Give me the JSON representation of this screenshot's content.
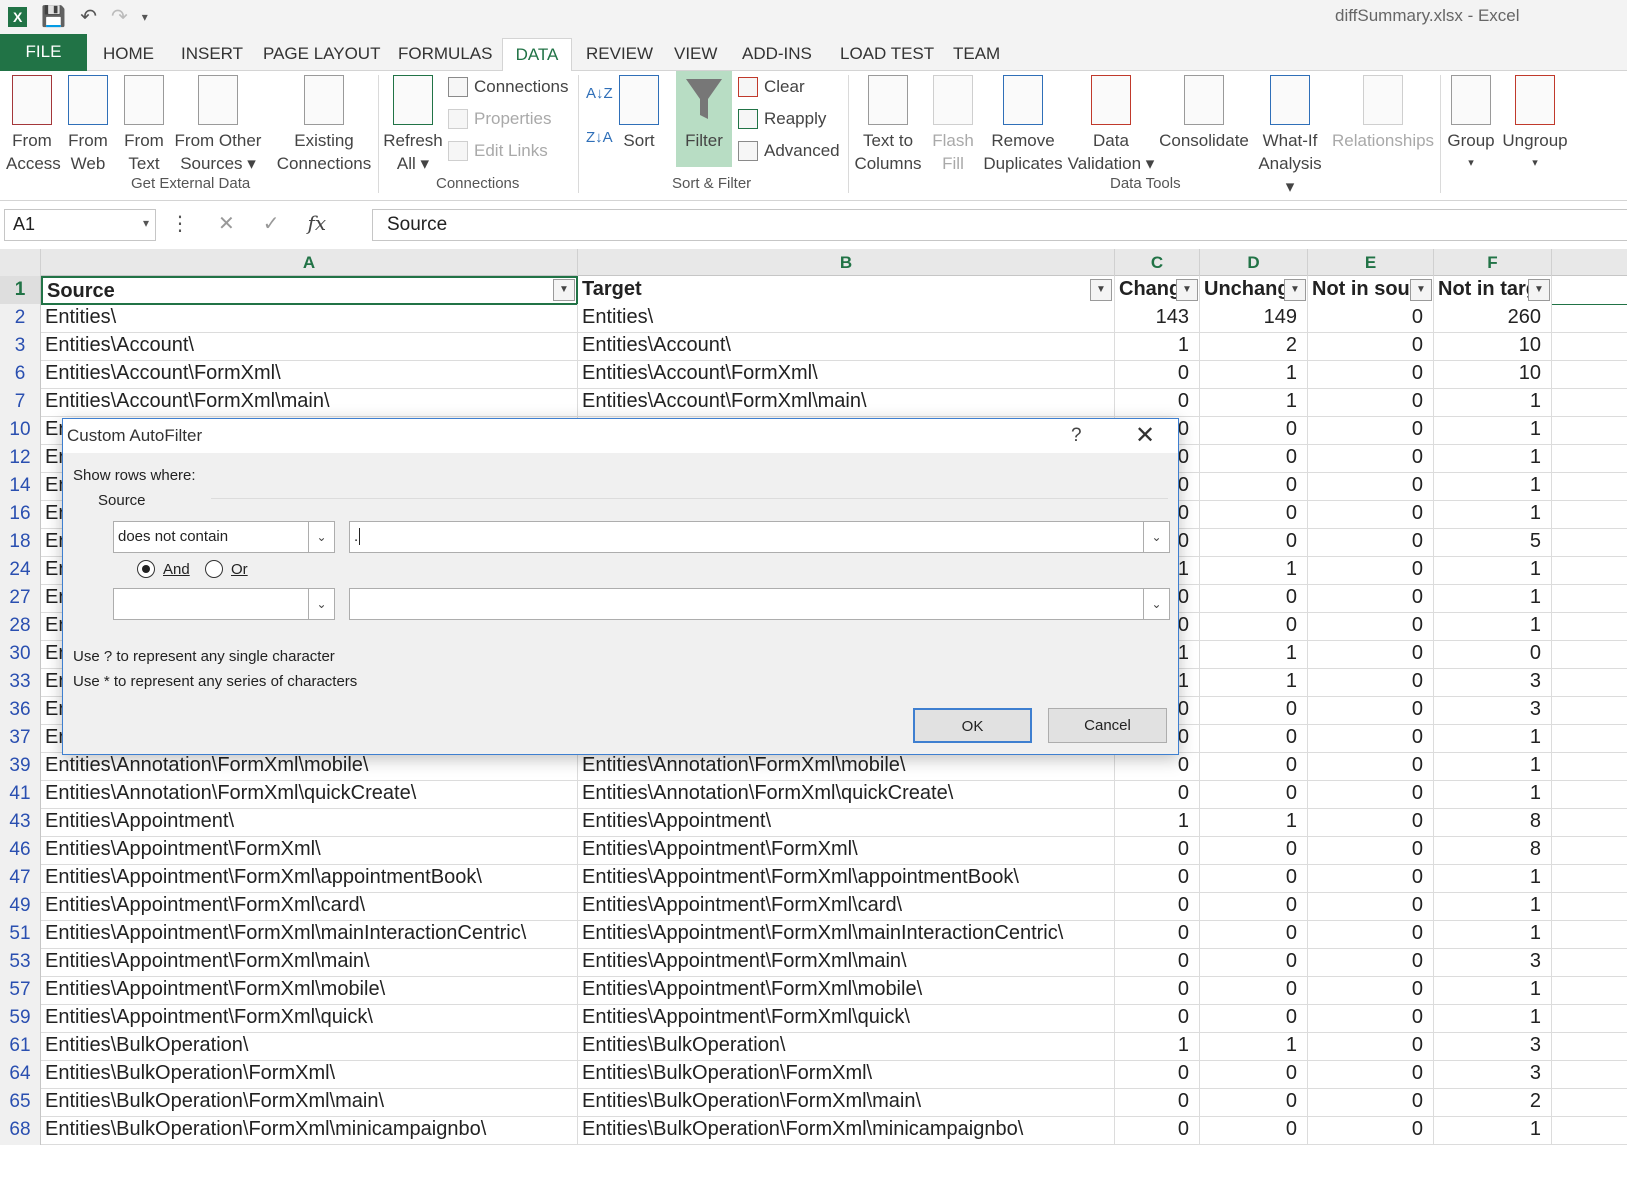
{
  "window": {
    "title": "diffSummary.xlsx - Excel"
  },
  "tabs": [
    "FILE",
    "HOME",
    "INSERT",
    "PAGE LAYOUT",
    "FORMULAS",
    "DATA",
    "REVIEW",
    "VIEW",
    "ADD-INS",
    "LOAD TEST",
    "TEAM"
  ],
  "ribbon": {
    "from_access": [
      "From",
      "Access"
    ],
    "from_web": [
      "From",
      "Web"
    ],
    "from_text": [
      "From",
      "Text"
    ],
    "from_other": [
      "From Other",
      "Sources ▾"
    ],
    "existing": [
      "Existing",
      "Connections"
    ],
    "get_external_label": "Get External Data",
    "refresh": [
      "Refresh",
      "All ▾"
    ],
    "connections": "Connections",
    "properties": "Properties",
    "edit_links": "Edit Links",
    "connections_label": "Connections",
    "sort": "Sort",
    "filter": "Filter",
    "clear": "Clear",
    "reapply": "Reapply",
    "advanced": "Advanced",
    "sort_filter_label": "Sort & Filter",
    "text_to_columns": [
      "Text to",
      "Columns"
    ],
    "flash_fill": [
      "Flash",
      "Fill"
    ],
    "remove_duplicates": [
      "Remove",
      "Duplicates"
    ],
    "data_validation": [
      "Data",
      "Validation ▾"
    ],
    "consolidate": "Consolidate",
    "what_if": [
      "What-If",
      "Analysis ▾"
    ],
    "relationships": "Relationships",
    "data_tools_label": "Data Tools",
    "group": [
      "Group",
      "▾"
    ],
    "ungroup": [
      "Ungroup",
      "▾"
    ]
  },
  "formula_bar": {
    "name_box": "A1",
    "formula": "Source"
  },
  "columns": [
    "A",
    "B",
    "C",
    "D",
    "E",
    "F"
  ],
  "header_row": {
    "num": "1",
    "a": "Source",
    "b": "Target",
    "c": "Chang",
    "d": "Unchang",
    "e": "Not in sour",
    "f": "Not in targ"
  },
  "rows": [
    {
      "n": "2",
      "a": "Entities\\",
      "b": "Entities\\",
      "c": "143",
      "d": "149",
      "e": "0",
      "f": "260"
    },
    {
      "n": "3",
      "a": "Entities\\Account\\",
      "b": "Entities\\Account\\",
      "c": "1",
      "d": "2",
      "e": "0",
      "f": "10"
    },
    {
      "n": "6",
      "a": "Entities\\Account\\FormXml\\",
      "b": "Entities\\Account\\FormXml\\",
      "c": "0",
      "d": "1",
      "e": "0",
      "f": "10"
    },
    {
      "n": "7",
      "a": "Entities\\Account\\FormXml\\main\\",
      "b": "Entities\\Account\\FormXml\\main\\",
      "c": "0",
      "d": "1",
      "e": "0",
      "f": "1"
    },
    {
      "n": "10",
      "a": "Er",
      "b": "",
      "c": "0",
      "d": "0",
      "e": "0",
      "f": "1"
    },
    {
      "n": "12",
      "a": "Er",
      "b": "",
      "c": "0",
      "d": "0",
      "e": "0",
      "f": "1"
    },
    {
      "n": "14",
      "a": "Er",
      "b": "",
      "c": "0",
      "d": "0",
      "e": "0",
      "f": "1"
    },
    {
      "n": "16",
      "a": "Er",
      "b": "",
      "c": "0",
      "d": "0",
      "e": "0",
      "f": "1"
    },
    {
      "n": "18",
      "a": "Er",
      "b": "",
      "c": "0",
      "d": "0",
      "e": "0",
      "f": "5"
    },
    {
      "n": "24",
      "a": "Er",
      "b": "",
      "c": "1",
      "d": "1",
      "e": "0",
      "f": "1"
    },
    {
      "n": "27",
      "a": "Er",
      "b": "",
      "c": "0",
      "d": "0",
      "e": "0",
      "f": "1"
    },
    {
      "n": "28",
      "a": "Er",
      "b": "",
      "c": "0",
      "d": "0",
      "e": "0",
      "f": "1"
    },
    {
      "n": "30",
      "a": "Er",
      "b": "",
      "c": "1",
      "d": "1",
      "e": "0",
      "f": "0"
    },
    {
      "n": "33",
      "a": "Er",
      "b": "",
      "c": "1",
      "d": "1",
      "e": "0",
      "f": "3"
    },
    {
      "n": "36",
      "a": "Er",
      "b": "",
      "c": "0",
      "d": "0",
      "e": "0",
      "f": "3"
    },
    {
      "n": "37",
      "a": "Er",
      "b": "",
      "c": "0",
      "d": "0",
      "e": "0",
      "f": "1"
    },
    {
      "n": "39",
      "a": "Entities\\Annotation\\FormXml\\mobile\\",
      "b": "Entities\\Annotation\\FormXml\\mobile\\",
      "c": "0",
      "d": "0",
      "e": "0",
      "f": "1"
    },
    {
      "n": "41",
      "a": "Entities\\Annotation\\FormXml\\quickCreate\\",
      "b": "Entities\\Annotation\\FormXml\\quickCreate\\",
      "c": "0",
      "d": "0",
      "e": "0",
      "f": "1"
    },
    {
      "n": "43",
      "a": "Entities\\Appointment\\",
      "b": "Entities\\Appointment\\",
      "c": "1",
      "d": "1",
      "e": "0",
      "f": "8"
    },
    {
      "n": "46",
      "a": "Entities\\Appointment\\FormXml\\",
      "b": "Entities\\Appointment\\FormXml\\",
      "c": "0",
      "d": "0",
      "e": "0",
      "f": "8"
    },
    {
      "n": "47",
      "a": "Entities\\Appointment\\FormXml\\appointmentBook\\",
      "b": "Entities\\Appointment\\FormXml\\appointmentBook\\",
      "c": "0",
      "d": "0",
      "e": "0",
      "f": "1"
    },
    {
      "n": "49",
      "a": "Entities\\Appointment\\FormXml\\card\\",
      "b": "Entities\\Appointment\\FormXml\\card\\",
      "c": "0",
      "d": "0",
      "e": "0",
      "f": "1"
    },
    {
      "n": "51",
      "a": "Entities\\Appointment\\FormXml\\mainInteractionCentric\\",
      "b": "Entities\\Appointment\\FormXml\\mainInteractionCentric\\",
      "c": "0",
      "d": "0",
      "e": "0",
      "f": "1"
    },
    {
      "n": "53",
      "a": "Entities\\Appointment\\FormXml\\main\\",
      "b": "Entities\\Appointment\\FormXml\\main\\",
      "c": "0",
      "d": "0",
      "e": "0",
      "f": "3"
    },
    {
      "n": "57",
      "a": "Entities\\Appointment\\FormXml\\mobile\\",
      "b": "Entities\\Appointment\\FormXml\\mobile\\",
      "c": "0",
      "d": "0",
      "e": "0",
      "f": "1"
    },
    {
      "n": "59",
      "a": "Entities\\Appointment\\FormXml\\quick\\",
      "b": "Entities\\Appointment\\FormXml\\quick\\",
      "c": "0",
      "d": "0",
      "e": "0",
      "f": "1"
    },
    {
      "n": "61",
      "a": "Entities\\BulkOperation\\",
      "b": "Entities\\BulkOperation\\",
      "c": "1",
      "d": "1",
      "e": "0",
      "f": "3"
    },
    {
      "n": "64",
      "a": "Entities\\BulkOperation\\FormXml\\",
      "b": "Entities\\BulkOperation\\FormXml\\",
      "c": "0",
      "d": "0",
      "e": "0",
      "f": "3"
    },
    {
      "n": "65",
      "a": "Entities\\BulkOperation\\FormXml\\main\\",
      "b": "Entities\\BulkOperation\\FormXml\\main\\",
      "c": "0",
      "d": "0",
      "e": "0",
      "f": "2"
    },
    {
      "n": "68",
      "a": "Entities\\BulkOperation\\FormXml\\minicampaignbo\\",
      "b": "Entities\\BulkOperation\\FormXml\\minicampaignbo\\",
      "c": "0",
      "d": "0",
      "e": "0",
      "f": "1"
    }
  ],
  "dialog": {
    "title": "Custom AutoFilter",
    "help": "?",
    "show_rows": "Show rows where:",
    "field": "Source",
    "op1": "does not contain",
    "val1": ".",
    "and_label": "And",
    "or_label": "Or",
    "logic": "and",
    "op2": "",
    "val2": "",
    "hint1": "Use ? to represent any single character",
    "hint2": "Use * to represent any series of characters",
    "ok": "OK",
    "cancel": "Cancel"
  },
  "colors": {
    "excel_green": "#217346",
    "row_header_blue": "#2a4fb0",
    "dialog_border": "#3e7fd0"
  }
}
